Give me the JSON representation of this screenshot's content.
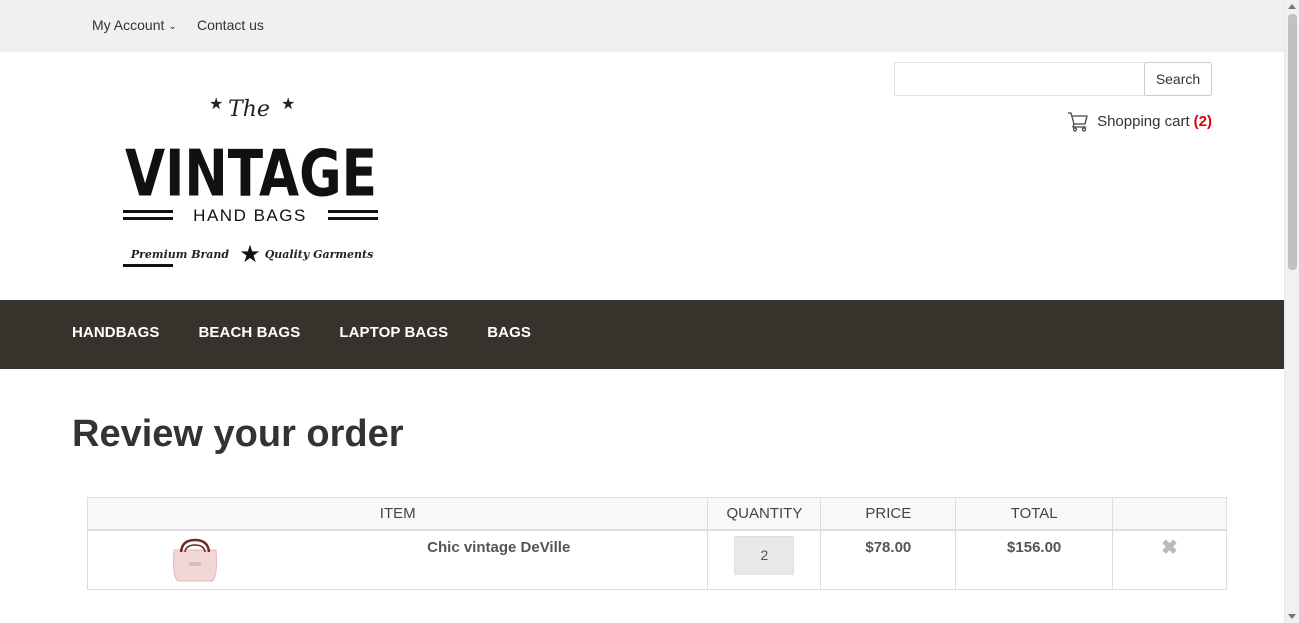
{
  "topbar": {
    "account_label": "My Account",
    "contact_label": "Contact us"
  },
  "logo": {
    "line_the": "The",
    "line_vintage": "VINTAGE",
    "line_handbags": "HAND BAGS",
    "tagline_left": "Premium Brand",
    "tagline_right": "Quality Garments"
  },
  "search": {
    "value": "",
    "placeholder": "",
    "button_label": "Search"
  },
  "cart": {
    "label": "Shopping cart",
    "count": "(2)",
    "count_color": "#dd0000"
  },
  "nav": {
    "items": [
      "HANDBAGS",
      "BEACH BAGS",
      "LAPTOP BAGS",
      "BAGS"
    ],
    "background": "#35332b"
  },
  "main": {
    "title": "Review your order",
    "table": {
      "headers": {
        "item": "ITEM",
        "quantity": "QUANTITY",
        "price": "PRICE",
        "total": "TOTAL"
      },
      "rows": [
        {
          "name": "Chic vintage DeVille",
          "quantity": "2",
          "price": "$78.00",
          "total": "$156.00",
          "remove_icon": "close-x-icon"
        }
      ]
    }
  }
}
